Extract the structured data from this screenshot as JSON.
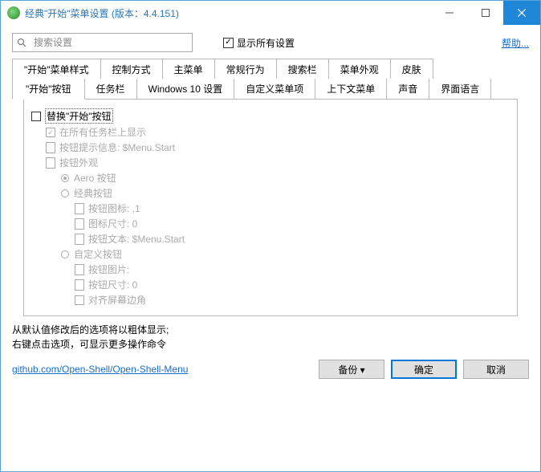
{
  "titlebar": {
    "text": "经典\"开始\"菜单设置 (版本：4.4.151)"
  },
  "search": {
    "placeholder": "搜索设置"
  },
  "showAll": {
    "label": "显示所有设置",
    "checked": true
  },
  "help": {
    "label": "帮助..."
  },
  "tabs": {
    "row1": [
      "\"开始\"菜单样式",
      "控制方式",
      "主菜单",
      "常规行为",
      "搜索栏",
      "菜单外观",
      "皮肤"
    ],
    "row2": [
      "\"开始\"按钮",
      "任务栏",
      "Windows 10 设置",
      "自定义菜单项",
      "上下文菜单",
      "声音",
      "界面语言"
    ],
    "active": "\"开始\"按钮"
  },
  "tree": [
    {
      "indent": 0,
      "type": "chk",
      "enabled": true,
      "label": "替换\"开始\"按钮"
    },
    {
      "indent": 1,
      "type": "chk",
      "enabled": false,
      "label": "在所有任务栏上显示",
      "checked": true
    },
    {
      "indent": 1,
      "type": "doc",
      "enabled": false,
      "label": "按钮提示信息: $Menu.Start"
    },
    {
      "indent": 1,
      "type": "doc",
      "enabled": false,
      "label": "按钮外观"
    },
    {
      "indent": 2,
      "type": "radio",
      "enabled": false,
      "label": "Aero 按钮",
      "sel": true
    },
    {
      "indent": 2,
      "type": "radio",
      "enabled": false,
      "label": "经典按钮"
    },
    {
      "indent": 3,
      "type": "doc",
      "enabled": false,
      "label": "按钮图标: ,1"
    },
    {
      "indent": 3,
      "type": "doc",
      "enabled": false,
      "label": "图标尺寸: 0"
    },
    {
      "indent": 3,
      "type": "doc",
      "enabled": false,
      "label": "按钮文本: $Menu.Start"
    },
    {
      "indent": 2,
      "type": "radio",
      "enabled": false,
      "label": "自定义按钮"
    },
    {
      "indent": 3,
      "type": "doc",
      "enabled": false,
      "label": "按钮图片:"
    },
    {
      "indent": 3,
      "type": "doc",
      "enabled": false,
      "label": "按钮尺寸: 0"
    },
    {
      "indent": 3,
      "type": "chk",
      "enabled": false,
      "label": "对齐屏幕边角"
    }
  ],
  "hints": {
    "line1": "从默认值修改后的选项将以粗体显示;",
    "line2": "右键点击选项，可显示更多操作命令"
  },
  "footer": {
    "link": "github.com/Open-Shell/Open-Shell-Menu",
    "backup": "备份",
    "ok": "确定",
    "cancel": "取消"
  }
}
